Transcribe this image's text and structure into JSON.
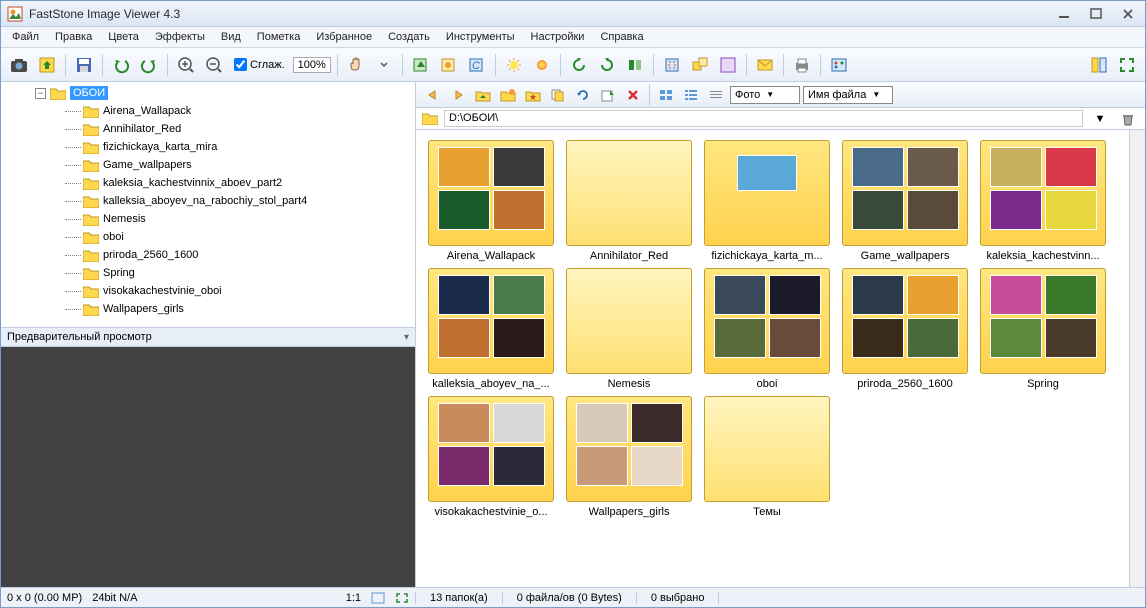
{
  "app": {
    "title": "FastStone Image Viewer 4.3"
  },
  "menu": [
    "Файл",
    "Правка",
    "Цвета",
    "Эффекты",
    "Вид",
    "Пометка",
    "Избранное",
    "Создать",
    "Инструменты",
    "Настройки",
    "Справка"
  ],
  "toolbar": {
    "smooth_label": "Сглаж.",
    "zoom_value": "100%"
  },
  "tree": {
    "root": "ОБОИ",
    "children": [
      "Airena_Wallapack",
      "Annihilator_Red",
      "fizichickaya_karta_mira",
      "Game_wallpapers",
      "kaleksia_kachestvinnix_aboev_part2",
      "kalleksia_aboyev_na_rabochiy_stol_part4",
      "Nemesis",
      "oboi",
      "priroda_2560_1600",
      "Spring",
      "visokakachestvinie_oboi",
      "Wallpapers_girls"
    ]
  },
  "preview": {
    "title": "Предварительный просмотр"
  },
  "nav": {
    "view_combo": "Фото",
    "sort_combo": "Имя файла",
    "path": "D:\\ОБОИ\\"
  },
  "thumbs": [
    {
      "label": "Airena_Wallapack",
      "minis": 4,
      "colors": [
        "#e8a030",
        "#3a3a3a",
        "#1a5a2a",
        "#c07030"
      ]
    },
    {
      "label": "Annihilator_Red",
      "minis": 0
    },
    {
      "label": "fizichickaya_karta_m...",
      "minis": 1,
      "colors": [
        "#5aa8d8"
      ]
    },
    {
      "label": "Game_wallpapers",
      "minis": 4,
      "colors": [
        "#4a6a8a",
        "#6a5a4a",
        "#3a4a3a",
        "#5a4a3a"
      ]
    },
    {
      "label": "kaleksia_kachestvinn...",
      "minis": 4,
      "colors": [
        "#c8b060",
        "#d83848",
        "#7a2a8a",
        "#e8d840"
      ]
    },
    {
      "label": "kalleksia_aboyev_na_...",
      "minis": 4,
      "colors": [
        "#1a2a4a",
        "#4a7a4a",
        "#c07030",
        "#2a1a1a"
      ]
    },
    {
      "label": "Nemesis",
      "minis": 0
    },
    {
      "label": "oboi",
      "minis": 4,
      "colors": [
        "#3a4a5a",
        "#1a1a2a",
        "#5a6a3a",
        "#6a4a3a"
      ]
    },
    {
      "label": "priroda_2560_1600",
      "minis": 4,
      "colors": [
        "#2a3a4a",
        "#e8a030",
        "#3a2a1a",
        "#4a6a3a"
      ]
    },
    {
      "label": "Spring",
      "minis": 4,
      "colors": [
        "#c84a9a",
        "#3a7a2a",
        "#5a8a3a",
        "#4a3a2a"
      ]
    },
    {
      "label": "visokakachestvinie_o...",
      "minis": 4,
      "colors": [
        "#c88a5a",
        "#d8d8d8",
        "#7a2a6a",
        "#2a2a3a"
      ]
    },
    {
      "label": "Wallpapers_girls",
      "minis": 4,
      "colors": [
        "#d8c8b8",
        "#3a2a2a",
        "#c89a7a",
        "#e8d8c8"
      ]
    },
    {
      "label": "Темы",
      "minis": 0
    }
  ],
  "status": {
    "dims": "0 x 0 (0.00 MP)",
    "depth": "24bit N/A",
    "ratio": "1:1",
    "folders": "13 папок(а)",
    "files": "0 файла/ов (0 Bytes)",
    "selected": "0 выбрано"
  }
}
